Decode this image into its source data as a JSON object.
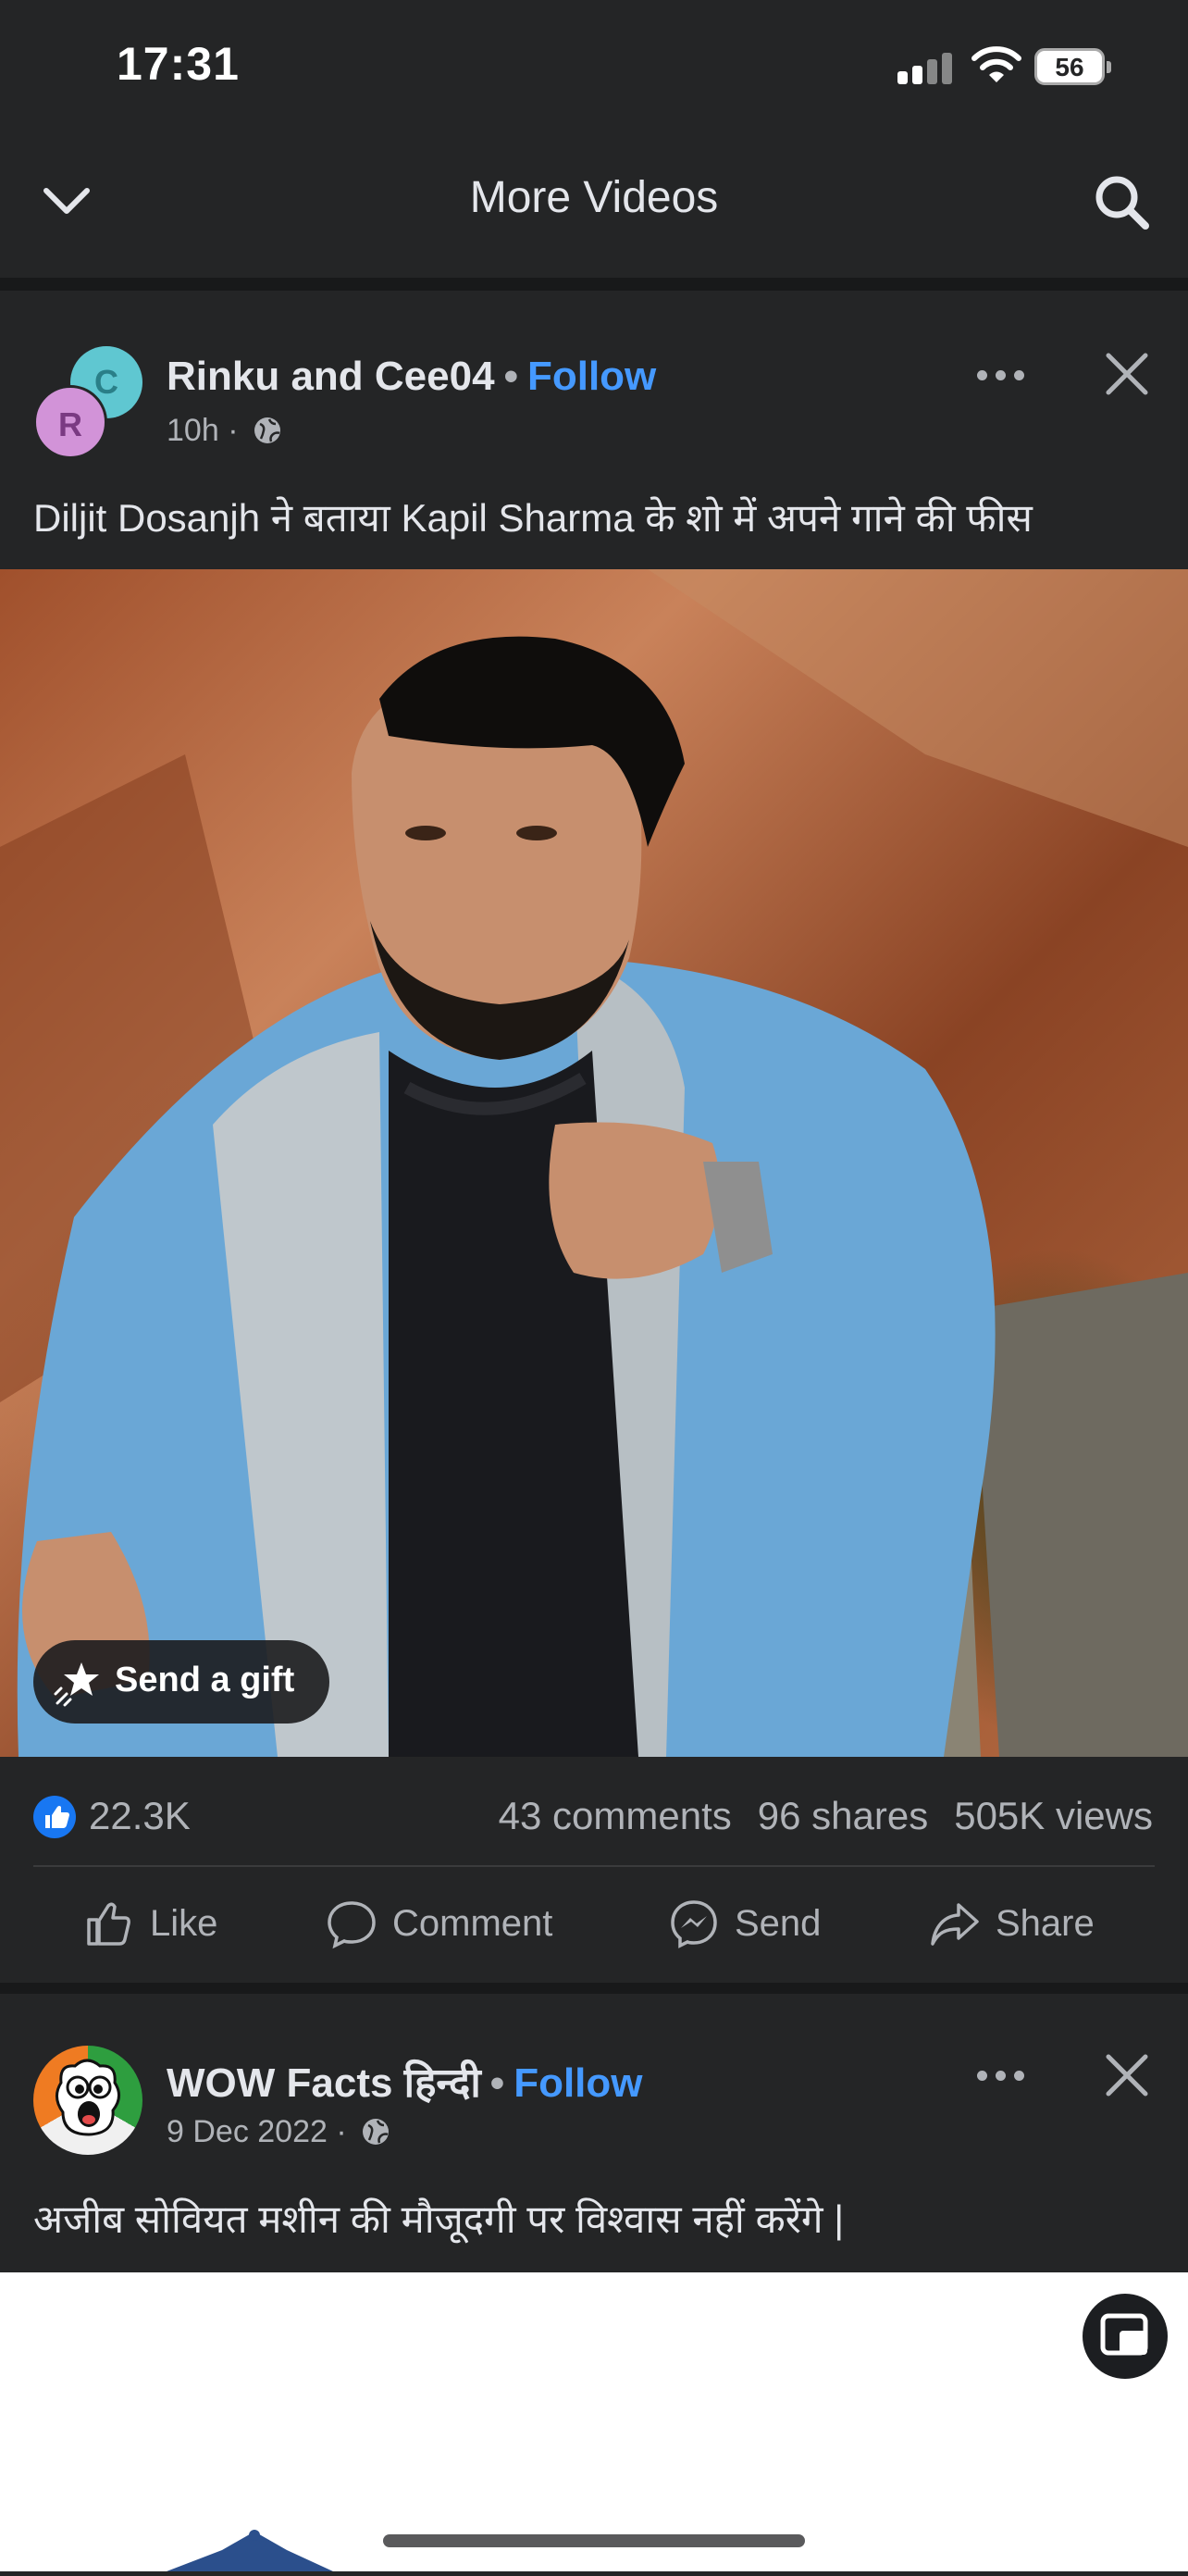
{
  "status_bar": {
    "time": "17:31",
    "battery": "56"
  },
  "header": {
    "title": "More Videos",
    "back_icon": "chevron-down-icon",
    "search_icon": "search-icon"
  },
  "post1": {
    "avatar_back_letter": "C",
    "avatar_front_letter": "R",
    "author": "Rinku and Cee04",
    "separator": "•",
    "follow": "Follow",
    "time": "10h",
    "meta_separator": "·",
    "caption": "Diljit Dosanjh ने बताया Kapil Sharma के शो में अपने गाने की फीस",
    "gift_label": "Send a gift",
    "likes": "22.3K",
    "comments": "43 comments",
    "shares": "96 shares",
    "views": "505K views",
    "actions": {
      "like": "Like",
      "comment": "Comment",
      "send": "Send",
      "share": "Share"
    }
  },
  "post2": {
    "author": "WOW Facts हिन्दी",
    "separator": "•",
    "follow": "Follow",
    "time": "9 Dec 2022",
    "meta_separator": "·",
    "caption": "अजीब सोवियत मशीन की मौजूदगी पर विश्वास नहीं करेंगे |"
  },
  "colors": {
    "background": "#242526",
    "follow": "#4599ff",
    "like_blue": "#1877f2",
    "text_secondary": "#b0b3b8"
  }
}
